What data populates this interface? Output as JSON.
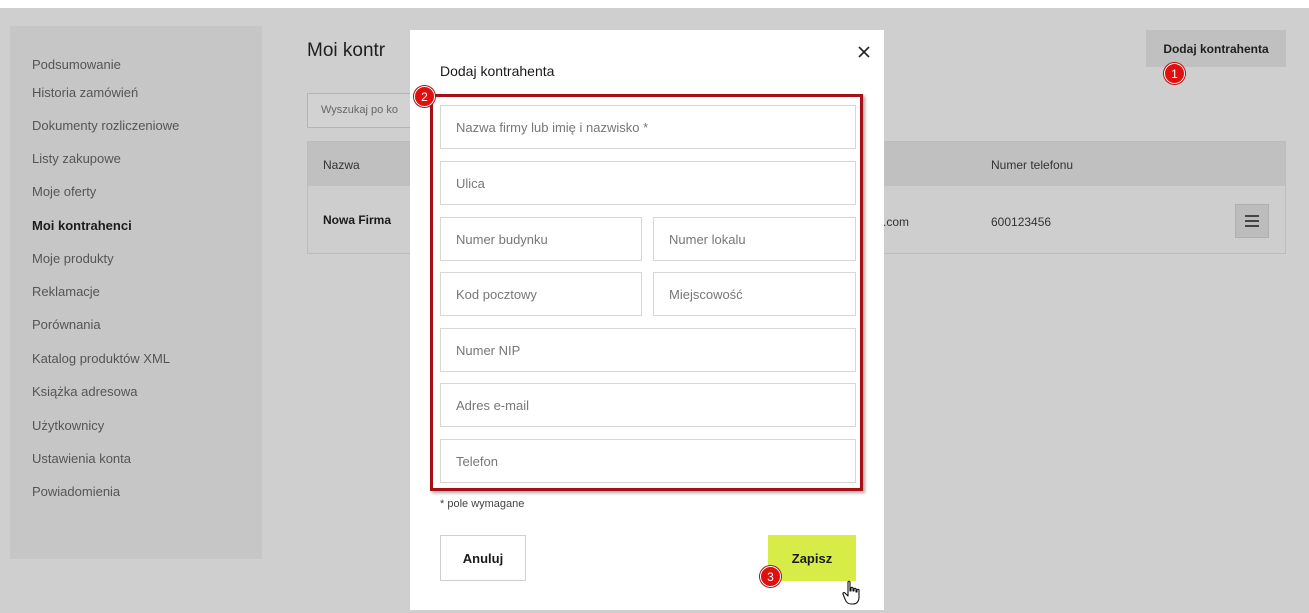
{
  "sidebar": {
    "items": [
      {
        "label": "Podsumowanie"
      },
      {
        "label": "Historia zamówień"
      },
      {
        "label": "Dokumenty rozliczeniowe"
      },
      {
        "label": "Listy zakupowe"
      },
      {
        "label": "Moje oferty"
      },
      {
        "label": "Moi kontrahenci"
      },
      {
        "label": "Moje produkty"
      },
      {
        "label": "Reklamacje"
      },
      {
        "label": "Porównania"
      },
      {
        "label": "Katalog produktów XML"
      },
      {
        "label": "Książka adresowa"
      },
      {
        "label": "Użytkownicy"
      },
      {
        "label": "Ustawienia konta"
      },
      {
        "label": "Powiadomienia"
      }
    ],
    "active": "Moi kontrahenci"
  },
  "page": {
    "title": "Moi kontr",
    "add_button_label": "Dodaj kontrahenta",
    "search_placeholder": "Wyszukaj po ko"
  },
  "table": {
    "headers": {
      "name": "Nazwa",
      "phone": "Numer telefonu"
    },
    "rows": [
      {
        "name": "Nowa Firma",
        "email_fragment": ".com",
        "phone": "600123456"
      }
    ]
  },
  "modal": {
    "title": "Dodaj kontrahenta",
    "fields": {
      "company": "Nazwa firmy lub imię i nazwisko *",
      "street": "Ulica",
      "building": "Numer budynku",
      "apartment": "Numer lokalu",
      "postal": "Kod pocztowy",
      "city": "Miejscowość",
      "nip": "Numer NIP",
      "email": "Adres e-mail",
      "phone": "Telefon"
    },
    "required_note": "* pole wymagane",
    "cancel_label": "Anuluj",
    "save_label": "Zapisz"
  },
  "markers": [
    "1",
    "2",
    "3"
  ],
  "colors": {
    "save_button": "#d7ec47",
    "highlight": "#a50f16",
    "marker": "#e0100e",
    "overlay": "#cfcfcf"
  },
  "icons": [
    "close-icon",
    "hamburger-menu-icon",
    "hand-cursor-icon"
  ]
}
